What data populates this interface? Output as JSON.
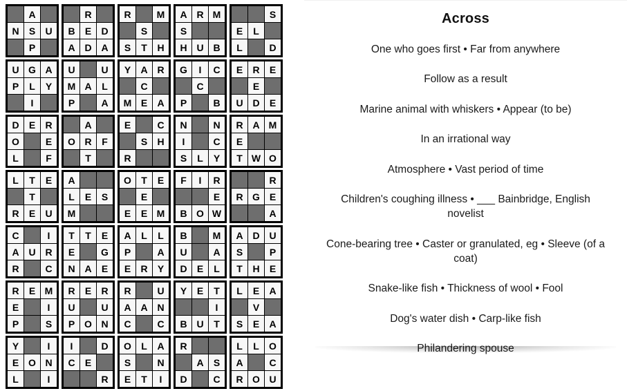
{
  "puzzle": {
    "rows": 7,
    "block_cols": 5,
    "block_size": 3,
    "colors": {
      "open_cell": "#f7f7f7",
      "blocked_cell": "#6e6e6e",
      "border": "#000000",
      "letter": "#000000"
    },
    "blocks": [
      [
        [
          [
            "",
            "A",
            ""
          ],
          [
            "N",
            "S",
            "U"
          ],
          [
            "",
            "P",
            ""
          ]
        ],
        [
          [
            "",
            "R",
            ""
          ],
          [
            "B",
            "E",
            "D"
          ],
          [
            "A",
            "D",
            "A"
          ]
        ],
        [
          [
            "R",
            "",
            "M"
          ],
          [
            "",
            "S",
            ""
          ],
          [
            "S",
            "T",
            "H"
          ]
        ],
        [
          [
            "A",
            "R",
            "M"
          ],
          [
            "S",
            "",
            ""
          ],
          [
            "H",
            "U",
            "B"
          ]
        ],
        [
          [
            "",
            "",
            "S"
          ],
          [
            "E",
            "L",
            ""
          ],
          [
            "L",
            "",
            "D"
          ]
        ]
      ],
      [
        [
          [
            "U",
            "G",
            "A"
          ],
          [
            "P",
            "L",
            "Y"
          ],
          [
            "",
            "I",
            ""
          ]
        ],
        [
          [
            "U",
            "",
            "U"
          ],
          [
            "M",
            "A",
            "L"
          ],
          [
            "P",
            "",
            "A"
          ]
        ],
        [
          [
            "Y",
            "A",
            "R"
          ],
          [
            "",
            "C",
            ""
          ],
          [
            "M",
            "E",
            "A"
          ]
        ],
        [
          [
            "G",
            "I",
            "C"
          ],
          [
            "",
            "C",
            ""
          ],
          [
            "P",
            "",
            "B"
          ]
        ],
        [
          [
            "E",
            "R",
            "E"
          ],
          [
            "",
            "E",
            ""
          ],
          [
            "U",
            "D",
            "E"
          ]
        ]
      ],
      [
        [
          [
            "D",
            "E",
            "R"
          ],
          [
            "O",
            "",
            "E"
          ],
          [
            "L",
            "",
            "F"
          ]
        ],
        [
          [
            "",
            "A",
            ""
          ],
          [
            "O",
            "R",
            "F"
          ],
          [
            "",
            "T",
            ""
          ]
        ],
        [
          [
            "E",
            "",
            "C"
          ],
          [
            "",
            "S",
            "H"
          ],
          [
            "R",
            "",
            ""
          ]
        ],
        [
          [
            "N",
            "",
            "N"
          ],
          [
            "I",
            "",
            "C"
          ],
          [
            "S",
            "L",
            "Y"
          ]
        ],
        [
          [
            "R",
            "A",
            "M"
          ],
          [
            "E",
            "",
            ""
          ],
          [
            "T",
            "W",
            "O"
          ]
        ]
      ],
      [
        [
          [
            "L",
            "T",
            "E"
          ],
          [
            "",
            "T",
            ""
          ],
          [
            "R",
            "E",
            "U"
          ]
        ],
        [
          [
            "A",
            "",
            ""
          ],
          [
            "L",
            "E",
            "S"
          ],
          [
            "M",
            "",
            ""
          ]
        ],
        [
          [
            "O",
            "T",
            "E"
          ],
          [
            "",
            "E",
            ""
          ],
          [
            "E",
            "E",
            "M"
          ]
        ],
        [
          [
            "F",
            "I",
            "R"
          ],
          [
            "",
            "",
            "E"
          ],
          [
            "B",
            "O",
            "W"
          ]
        ],
        [
          [
            "",
            "",
            "R"
          ],
          [
            "R",
            "G",
            "E"
          ],
          [
            "",
            "",
            "A"
          ]
        ]
      ],
      [
        [
          [
            "C",
            "",
            "I"
          ],
          [
            "A",
            "U",
            "R"
          ],
          [
            "R",
            "",
            "C"
          ]
        ],
        [
          [
            "T",
            "T",
            "E"
          ],
          [
            "E",
            "",
            "G"
          ],
          [
            "N",
            "A",
            "E"
          ]
        ],
        [
          [
            "A",
            "L",
            "L"
          ],
          [
            "P",
            "",
            "A"
          ],
          [
            "E",
            "R",
            "Y"
          ]
        ],
        [
          [
            "B",
            "",
            "M"
          ],
          [
            "U",
            "",
            "A"
          ],
          [
            "D",
            "E",
            "L"
          ]
        ],
        [
          [
            "A",
            "D",
            "U"
          ],
          [
            "S",
            "",
            "P"
          ],
          [
            "T",
            "H",
            "E"
          ]
        ]
      ],
      [
        [
          [
            "R",
            "E",
            "M"
          ],
          [
            "E",
            "",
            "I"
          ],
          [
            "P",
            "",
            "S"
          ]
        ],
        [
          [
            "R",
            "E",
            "R"
          ],
          [
            "U",
            "",
            "U"
          ],
          [
            "P",
            "O",
            "N"
          ]
        ],
        [
          [
            "R",
            "",
            "U"
          ],
          [
            "A",
            "A",
            "N"
          ],
          [
            "C",
            "",
            "C"
          ]
        ],
        [
          [
            "Y",
            "E",
            "T"
          ],
          [
            "",
            "",
            "I"
          ],
          [
            "B",
            "U",
            "T"
          ]
        ],
        [
          [
            "L",
            "E",
            "A"
          ],
          [
            "",
            "V",
            ""
          ],
          [
            "S",
            "E",
            "A"
          ]
        ]
      ],
      [
        [
          [
            "Y",
            "",
            "I"
          ],
          [
            "E",
            "O",
            "N"
          ],
          [
            "L",
            "",
            "I"
          ]
        ],
        [
          [
            "I",
            "",
            "D"
          ],
          [
            "C",
            "E",
            ""
          ],
          [
            "",
            "",
            "R"
          ]
        ],
        [
          [
            "O",
            "L",
            "A"
          ],
          [
            "S",
            "",
            "N"
          ],
          [
            "E",
            "T",
            "I"
          ]
        ],
        [
          [
            "R",
            "",
            ""
          ],
          [
            "",
            "A",
            "S"
          ],
          [
            "D",
            "",
            "C"
          ]
        ],
        [
          [
            "L",
            "L",
            "O"
          ],
          [
            "A",
            "",
            "C"
          ],
          [
            "R",
            "O",
            "U"
          ]
        ]
      ]
    ]
  },
  "clues": {
    "title": "Across",
    "items": [
      "One who goes first • Far from anywhere",
      "Follow as a result",
      "Marine animal with whiskers • Appear (to be)",
      "In an irrational way",
      "Atmosphere • Vast period of time",
      "Children's coughing illness • ___ Bainbridge, English novelist",
      "Cone-bearing tree • Caster or granulated, eg • Sleeve (of a coat)",
      "Snake-like fish • Thickness of wool • Fool",
      "Dog's water dish • Carp-like fish",
      "Philandering spouse"
    ]
  }
}
